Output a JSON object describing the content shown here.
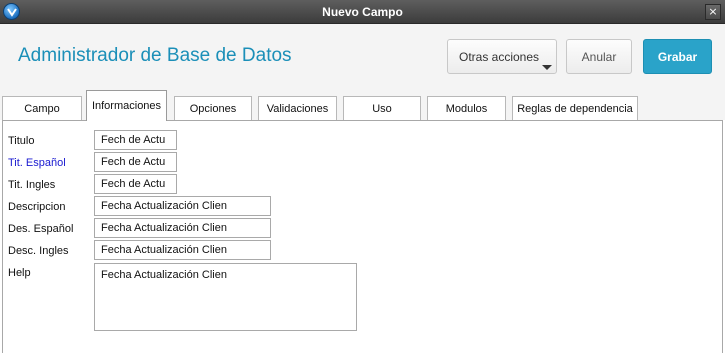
{
  "window": {
    "title": "Nuevo Campo",
    "close_glyph": "×",
    "icon": "app-logo-icon"
  },
  "header": {
    "title": "Administrador de Base de Datos",
    "more_actions_label": "Otras acciones",
    "cancel_label": "Anular",
    "save_label": "Grabar",
    "accent_color": "#1b8fb8",
    "save_color": "#2aa3c9"
  },
  "tabs": [
    {
      "label": "Campo",
      "active": false
    },
    {
      "label": "Informaciones",
      "active": true
    },
    {
      "label": "Opciones",
      "active": false
    },
    {
      "label": "Validaciones",
      "active": false
    },
    {
      "label": "Uso",
      "active": false
    },
    {
      "label": "Modulos",
      "active": false
    },
    {
      "label": "Reglas de dependencia",
      "active": false
    }
  ],
  "form": {
    "titulo": {
      "label": "Titulo",
      "value": "Fech de Actu"
    },
    "tit_espanol": {
      "label": "Tit. Español",
      "value": "Fech de Actu"
    },
    "tit_ingles": {
      "label": "Tit. Ingles",
      "value": "Fech de Actu"
    },
    "descripcion": {
      "label": "Descripcion",
      "value": "Fecha Actualización Clien"
    },
    "des_espanol": {
      "label": "Des. Español",
      "value": "Fecha Actualización Clien"
    },
    "desc_ingles": {
      "label": "Desc. Ingles",
      "value": "Fecha Actualización Clien"
    },
    "help": {
      "label": "Help",
      "value": "Fecha Actualización Clien"
    }
  }
}
